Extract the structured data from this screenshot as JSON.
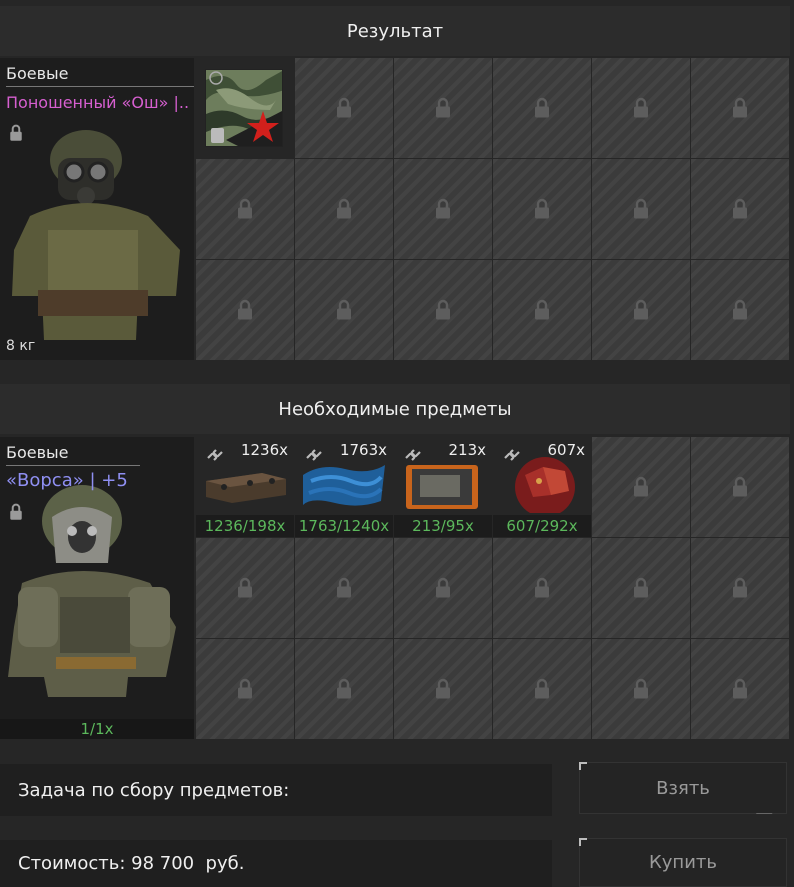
{
  "result": {
    "header": "Результат",
    "category": "Боевые",
    "item_name": "Поношенный «Ош» |..",
    "item_name_color": "#d65fd0",
    "weight": "8 кг"
  },
  "required": {
    "header": "Необходимые предметы",
    "category": "Боевые",
    "item_name": "«Ворса» | +5",
    "item_name_color": "#8f8ff2",
    "count": "1/1x",
    "items": [
      {
        "qty": "1236x",
        "req": "1236/198x",
        "icon": "plate-material-icon"
      },
      {
        "qty": "1763x",
        "req": "1763/1240x",
        "icon": "blue-fiber-icon"
      },
      {
        "qty": "213x",
        "req": "213/95x",
        "icon": "orange-panel-icon"
      },
      {
        "qty": "607x",
        "req": "607/292x",
        "icon": "red-crystal-icon"
      }
    ]
  },
  "task": {
    "label": "Задача по сбору предметов:"
  },
  "cost": {
    "label": "Стоимость: 98 700  руб."
  },
  "buttons": {
    "take": "Взять",
    "buy": "Купить"
  },
  "colors": {
    "accent_green": "#5cb85c",
    "panel": "#2c2c2c"
  }
}
